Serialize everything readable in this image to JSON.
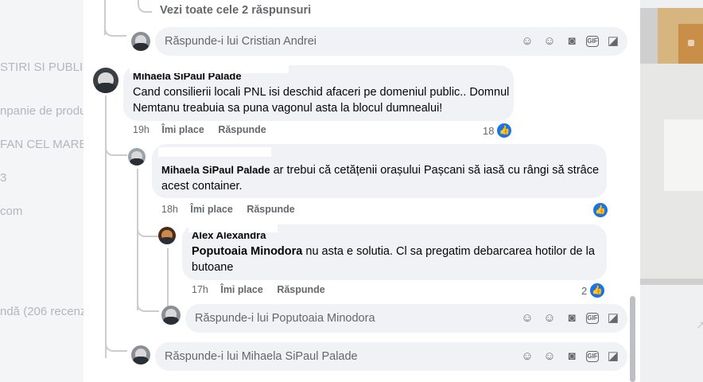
{
  "background_left": {
    "lines": [
      "STIRI SI PUBLIC",
      "npanie de produ",
      "FAN CEL MARE",
      "3",
      "com",
      "ndă (206 recenz"
    ]
  },
  "thread": {
    "view_all": "Vezi toate cele 2 răspunsuri",
    "reply_cristian_placeholder": "Răspunde-i lui Cristian Andrei",
    "comment1": {
      "author": "Mihaela SiPaul Palade",
      "text": "Cand consilierii locali PNL isi deschid afaceri pe domeniul public.. Domnul Nemtanu treabuia sa puna vagonul asta la blocul dumnealui!",
      "time": "19h",
      "like_label": "Îmi place",
      "reply_label": "Răspunde",
      "reaction_count": "18"
    },
    "comment2": {
      "author": "Mihaela SiPaul Palade",
      "text": "ar trebui că cetățenii orașului Pașcani să iasă cu rângi să strâce acest container.",
      "time": "18h",
      "like_label": "Îmi place",
      "reply_label": "Răspunde",
      "reaction_count": ""
    },
    "comment3": {
      "author": "Alex Alexandra",
      "mention": "Poputoaia Minodora",
      "text": "nu asta e solutia. Cl sa pregatim debarcarea hotilor de la butoane",
      "time": "17h",
      "like_label": "Îmi place",
      "reply_label": "Răspunde",
      "reaction_count": "2"
    },
    "reply_poputoaia_placeholder": "Răspunde-i lui Poputoaia Minodora",
    "reply_mihaela_placeholder": "Răspunde-i lui Mihaela SiPaul Palade"
  },
  "icons": [
    "avatar-sticker-icon",
    "emoji-icon",
    "camera-icon",
    "gif-icon",
    "sticker-icon"
  ],
  "colors": {
    "like_blue": "#1b74e4",
    "bubble_bg": "#f0f2f5",
    "meta_gray": "#65676b"
  }
}
